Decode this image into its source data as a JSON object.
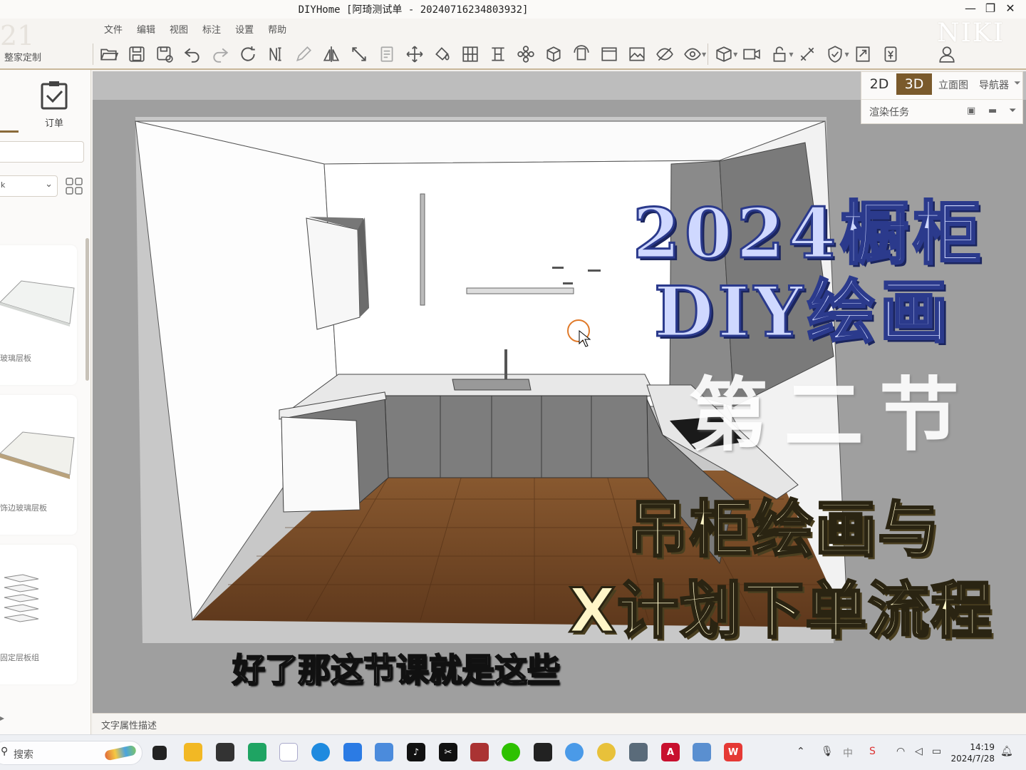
{
  "window": {
    "title": "DIYHome [阿琦测试单 - 20240716234803932]",
    "controls": [
      "—",
      "❐",
      "✕"
    ]
  },
  "brand": {
    "ghost": "21",
    "label": "整家定制",
    "watermark": "NIKI"
  },
  "menu": [
    "文件",
    "编辑",
    "视图",
    "标注",
    "设置",
    "帮助"
  ],
  "toolbar": [
    "folder-open",
    "save",
    "save-as",
    "undo",
    "redo",
    "refresh",
    "dimension",
    "pencil",
    "mirror",
    "line-measure",
    "document",
    "move",
    "paint-bucket",
    "grid-split",
    "column",
    "flower",
    "cabinet-3d",
    "cabinet-rotate",
    "window",
    "image",
    "hide-eye",
    "view-eye",
    "box",
    "camera",
    "lock",
    "tools",
    "shield",
    "export",
    "price"
  ],
  "left_panel": {
    "order_label": "订单",
    "select_value": "k",
    "cards": [
      {
        "caption": "玻璃层板"
      },
      {
        "caption": "饰边玻璃层板"
      },
      {
        "caption": "固定层板组"
      }
    ]
  },
  "view_tabs": {
    "tab_2d": "2D",
    "tab_3d": "3D",
    "elevation": "立面图",
    "navigator": "导航器",
    "active": "3D"
  },
  "render_task": "渲染任务",
  "overlay": {
    "year_line": "2024橱柜",
    "diy_line": "DIY绘画",
    "section": "第二节",
    "subtitle1": "吊柜绘画与",
    "subtitle2": "X计划下单流程",
    "caption": "好了那这节课就是这些"
  },
  "status_bar": "文字属性描述",
  "taskbar": {
    "search_placeholder": "搜索",
    "ime": "中",
    "time": "14:19",
    "date": "2024/7/28"
  },
  "colors": {
    "accent": "#7a5a2c",
    "floor": "#7a4a26",
    "cabinet_gray": "#7f7f7f",
    "wall": "#ffffff",
    "viewport_bg": "#a9a9a9"
  }
}
